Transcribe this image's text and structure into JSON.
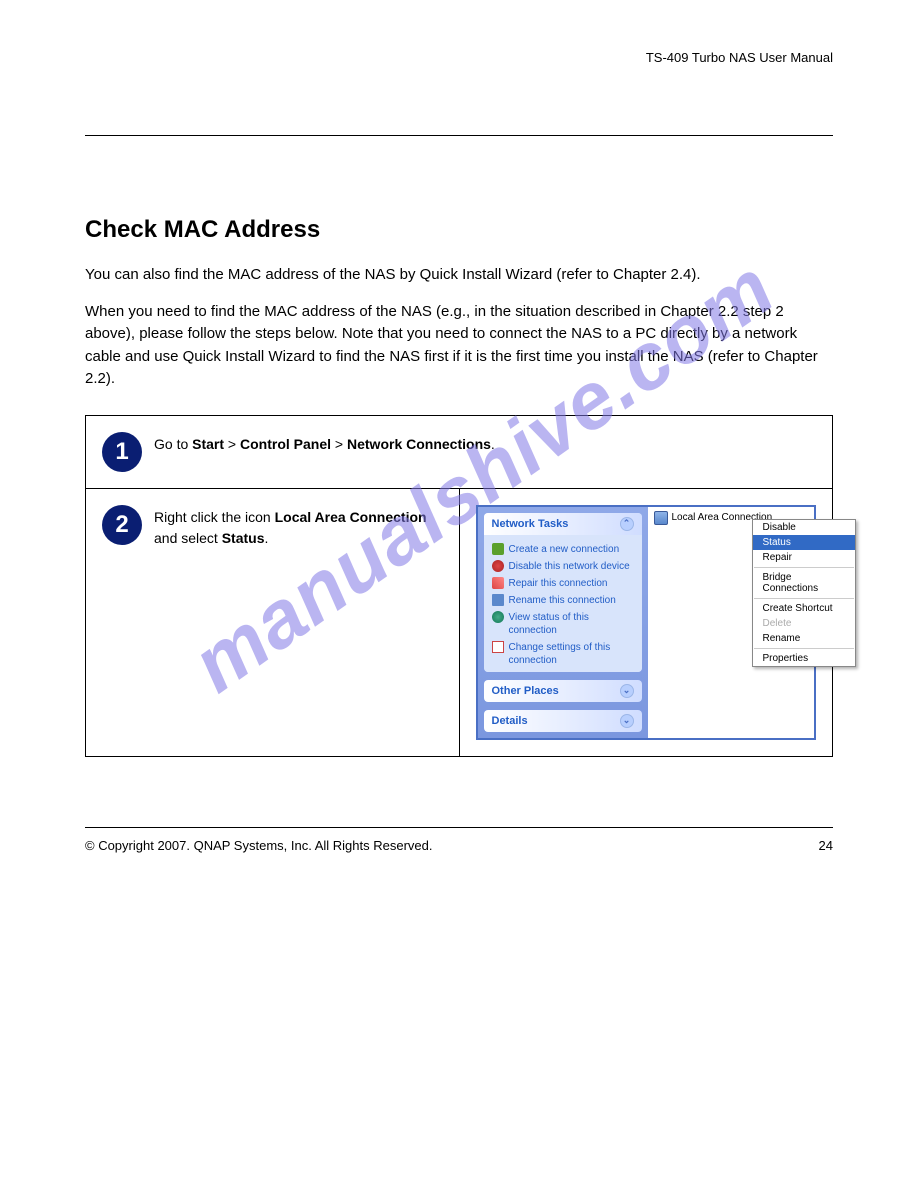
{
  "header": {
    "breadcrumb": "TS-409 Turbo NAS User Manual"
  },
  "section": {
    "title": "Check MAC Address",
    "p1": "You can also find the MAC address of the NAS by Quick Install Wizard (refer to Chapter 2.4).",
    "p2": "When you need to find the MAC address of the NAS (e.g., in the situation described in Chapter 2.2 step 2 above), please follow the steps below. Note that you need to connect the NAS to a PC directly by a network cable and use Quick Install Wizard to find the NAS first if it is the first time you install the NAS (refer to Chapter 2.2)."
  },
  "steps": {
    "s1": {
      "text_parts": [
        "Go to ",
        "Start",
        " > ",
        "Control Panel",
        " > ",
        "Network Connections",
        "."
      ]
    },
    "s2": {
      "text_parts": [
        "Right click the icon ",
        "Local Area Connection",
        " and select ",
        "Status",
        "."
      ]
    }
  },
  "xp_panel": {
    "tasks_title": "Network Tasks",
    "tasks": [
      "Create a new connection",
      "Disable this network device",
      "Repair this connection",
      "Rename this connection",
      "View status of this connection",
      "Change settings of this connection"
    ],
    "other_places": "Other Places",
    "details": "Details"
  },
  "connection_label": "Local Area Connection",
  "context_menu": {
    "items": [
      {
        "label": "Disable",
        "type": "item"
      },
      {
        "label": "Status",
        "type": "highlighted"
      },
      {
        "label": "Repair",
        "type": "item"
      },
      {
        "type": "sep"
      },
      {
        "label": "Bridge Connections",
        "type": "item"
      },
      {
        "type": "sep"
      },
      {
        "label": "Create Shortcut",
        "type": "item"
      },
      {
        "label": "Delete",
        "type": "disabled"
      },
      {
        "label": "Rename",
        "type": "item"
      },
      {
        "type": "sep"
      },
      {
        "label": "Properties",
        "type": "item"
      }
    ]
  },
  "footer": {
    "copyright": "© Copyright 2007. QNAP Systems, Inc. All Rights Reserved.",
    "page": "24"
  },
  "watermark": "manualshive.com"
}
